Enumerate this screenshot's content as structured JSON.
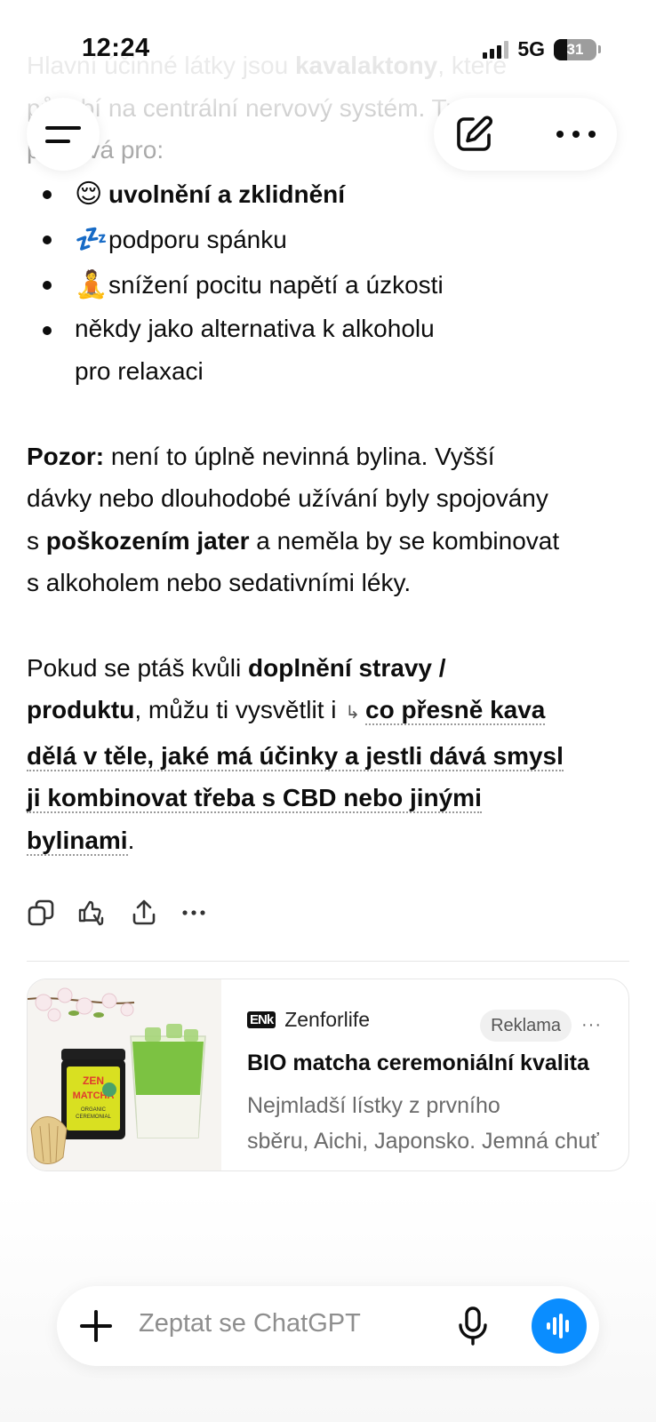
{
  "status_bar": {
    "time": "12:24",
    "network": "5G",
    "battery": "31",
    "battery_level": 0.31
  },
  "intro": {
    "line1_before": "Hlavní účinné látky jsou ",
    "line1_bold": "kavalaktony",
    "line1_after": ", které",
    "line2": "působí na centrální nervový systém. Tradičně se",
    "line3": "používá pro:"
  },
  "bullets": [
    {
      "emoji": "😌",
      "text": "uvolnění a zklidnění",
      "bold": true
    },
    {
      "emoji": "💤",
      "text": "podporu spánku",
      "bold": false
    },
    {
      "emoji": "🧘",
      "text": "snížení pocitu napětí a úzkosti",
      "bold": false
    },
    {
      "emoji": "",
      "text_line1": "někdy jako alternativa k alkoholu",
      "text_line2": "pro relaxaci",
      "bold": false
    }
  ],
  "warning": {
    "label": "Pozor:",
    "text1": " není to úplně nevinná bylina. Vyšší",
    "text2": "dávky nebo dlouhodobé užívání byly spojovány",
    "text3a": "s ",
    "bold": "poškozením jater",
    "text3b": " a neměla by se kombinovat",
    "text4": "s alkoholem nebo sedativními léky."
  },
  "closing": {
    "before": "Pokud se ptáš kvůli ",
    "bold1": "doplnění stravy /",
    "bold2": "produktu",
    "middle": ", můžu ti vysvětlit i ",
    "arrow": "↳",
    "link1": "co přesně kava",
    "link2": "dělá v těle, jaké má účinky a jestli dává smysl",
    "link3": "ji kombinovat třeba s CBD nebo jinými",
    "link4": "bylinami",
    "end": "."
  },
  "actions": [
    "copy-icon",
    "feedback-icon",
    "share-icon",
    "more-icon"
  ],
  "ad": {
    "brand_logo": "ENk",
    "brand": "Zenforlife",
    "badge": "Reklama",
    "more": "···",
    "title": "BIO matcha ceremoniální kvalita",
    "desc_line1": "Nejmladší lístky z prvního",
    "desc_line2": "sběru, Aichi, Japonsko. Jemná chuť",
    "product_label_line1": "ZEN",
    "product_label_line2": "MATCHA",
    "product_label_line3": "ORGANIC",
    "product_label_line4": "CEREMONIAL"
  },
  "composer": {
    "placeholder": "Zeptat se ChatGPT"
  },
  "colors": {
    "accent": "#0a8dff",
    "text": "#0d0d0d",
    "muted": "#6b6b6b"
  }
}
